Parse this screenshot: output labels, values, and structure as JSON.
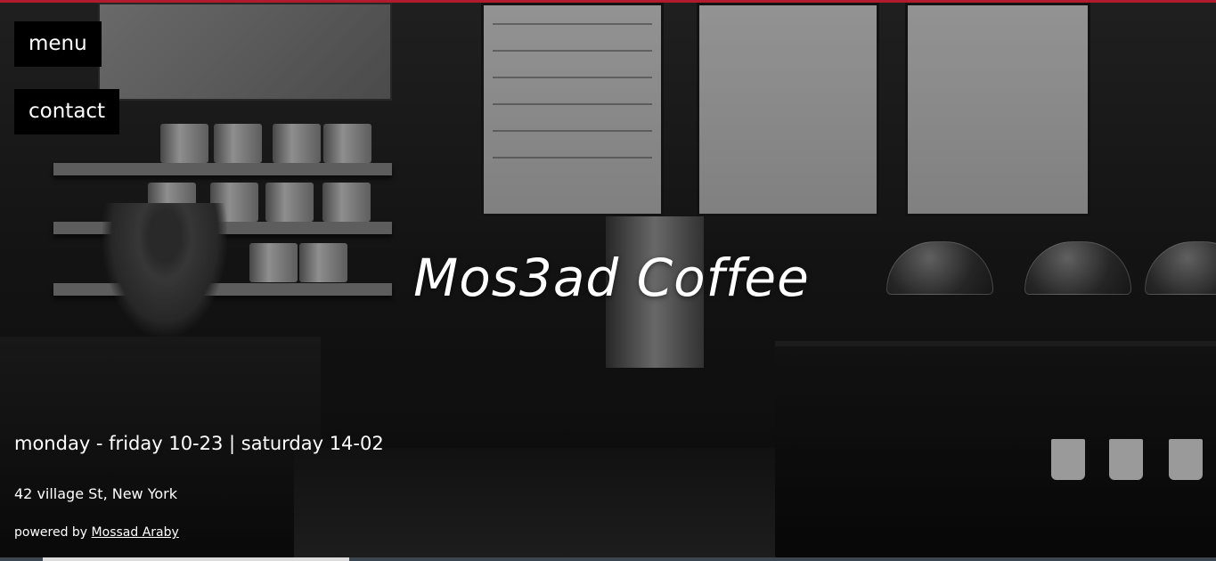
{
  "nav": {
    "menu_label": "menu",
    "contact_label": "contact"
  },
  "hero": {
    "title": "Mos3ad Coffee",
    "hours": "monday - friday 10-23 | saturday 14-02",
    "address": "42 village St, New York",
    "powered_prefix": "powered by",
    "powered_author": "Mossad Araby"
  },
  "colors": {
    "accent_top": "#b01c2e",
    "nav_bg": "#000000",
    "text": "#ffffff"
  }
}
